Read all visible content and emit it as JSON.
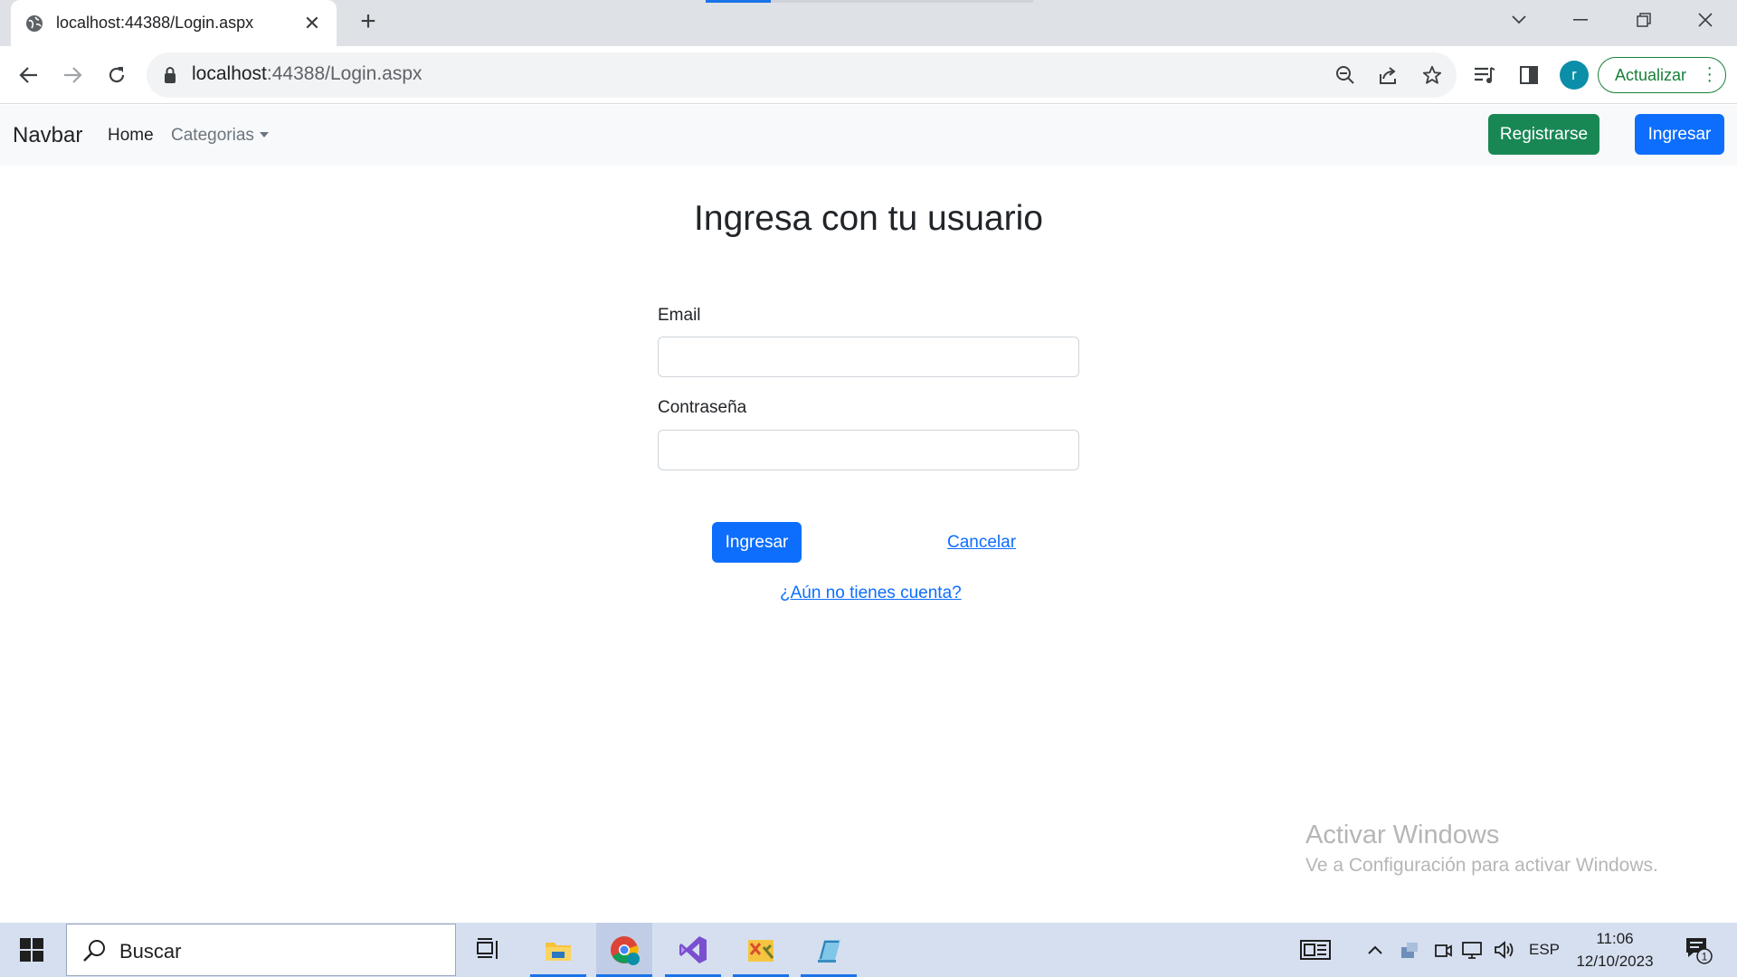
{
  "browser": {
    "tab_title": "localhost:44388/Login.aspx",
    "tab_close": "✕",
    "new_tab": "+",
    "url_host": "localhost",
    "url_rest": ":44388/Login.aspx",
    "update_label": "Actualizar",
    "profile_initial": "r"
  },
  "navbar": {
    "brand": "Navbar",
    "home": "Home",
    "categories": "Categorias",
    "register_button": "Registrarse",
    "login_button": "Ingresar"
  },
  "login": {
    "title": "Ingresa con tu usuario",
    "email_label": "Email",
    "email_value": "",
    "password_label": "Contraseña",
    "password_value": "",
    "submit_button": "Ingresar",
    "cancel_link": "Cancelar",
    "signup_link": "¿Aún no tienes cuenta?"
  },
  "watermark": {
    "title": "Activar Windows",
    "subtitle": "Ve a Configuración para activar Windows."
  },
  "taskbar": {
    "search_placeholder": "Buscar",
    "language": "ESP",
    "time": "11:06",
    "date": "12/10/2023",
    "notification_count": "1"
  },
  "colors": {
    "primary": "#0d6efd",
    "success": "#198754",
    "navbar_bg": "#f8f9fa"
  }
}
